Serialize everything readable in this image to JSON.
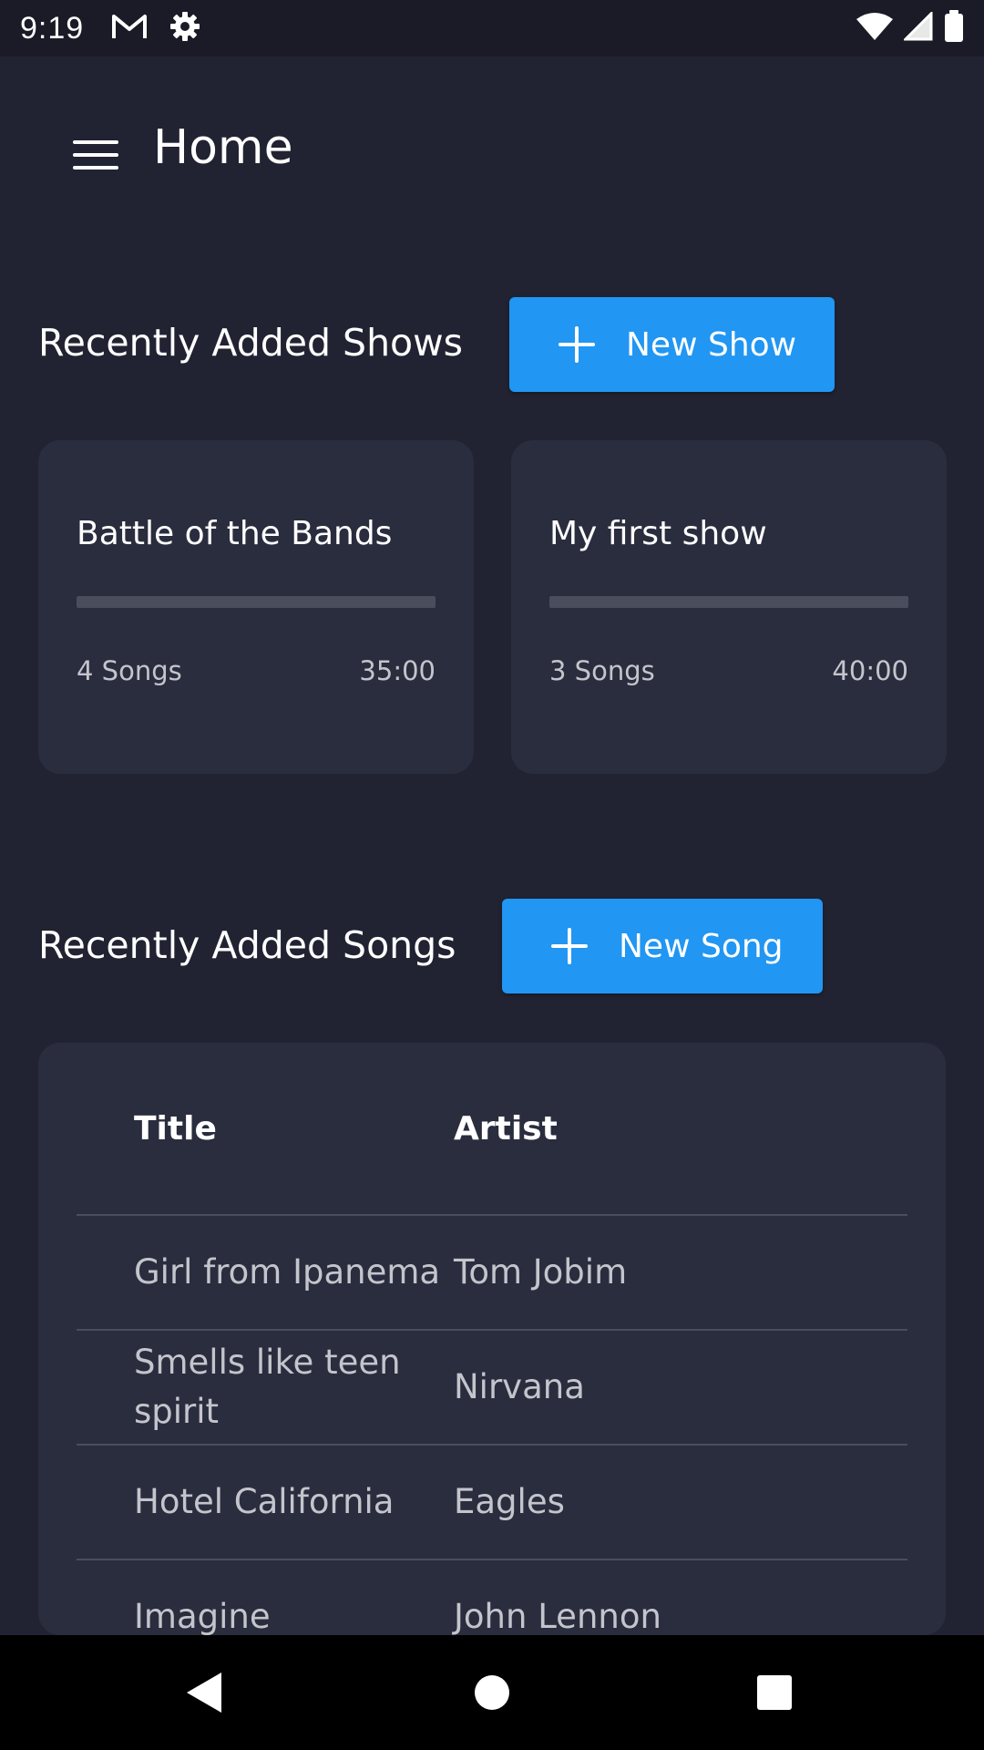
{
  "status_bar": {
    "time": "9:19",
    "left_icons": [
      "gmail-icon",
      "settings-gear-icon"
    ],
    "right_icons": [
      "wifi-icon",
      "signal-icon",
      "battery-icon"
    ]
  },
  "app_bar": {
    "title": "Home",
    "menu_icon": "hamburger-menu-icon"
  },
  "shows_section": {
    "title": "Recently Added Shows",
    "new_button_label": "New Show",
    "shows": [
      {
        "name": "Battle of the Bands",
        "songs": "4 Songs",
        "duration": "35:00"
      },
      {
        "name": "My first show",
        "songs": "3 Songs",
        "duration": "40:00"
      }
    ]
  },
  "songs_section": {
    "title": "Recently Added Songs",
    "new_button_label": "New Song",
    "columns": {
      "title": "Title",
      "artist": "Artist"
    },
    "rows": [
      {
        "title": "Girl from Ipanema",
        "artist": "Tom Jobim"
      },
      {
        "title": "Smells like teen spirit",
        "artist": "Nirvana"
      },
      {
        "title": "Hotel California",
        "artist": "Eagles"
      },
      {
        "title": "Imagine",
        "artist": "John Lennon"
      }
    ]
  },
  "nav_bar": {
    "icons": [
      "back-triangle-icon",
      "home-circle-icon",
      "recents-square-icon"
    ]
  },
  "colors": {
    "background": "#212332",
    "card": "#2a2d3e",
    "accent": "#2196f3",
    "muted_text": "#c4c5cc"
  }
}
